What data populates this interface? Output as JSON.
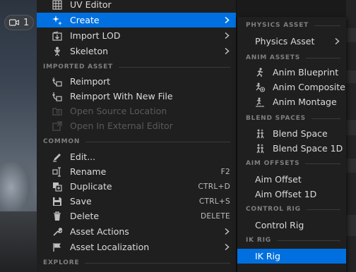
{
  "viewport": {
    "camera_label": "1"
  },
  "main_menu": {
    "items_top": [
      {
        "label": "UV Editor"
      },
      {
        "label": "Create"
      },
      {
        "label": "Import LOD"
      },
      {
        "label": "Skeleton"
      }
    ],
    "section_imported": "IMPORTED ASSET",
    "items_imported": [
      {
        "label": "Reimport"
      },
      {
        "label": "Reimport With New File"
      },
      {
        "label": "Open Source Location"
      },
      {
        "label": "Open In External Editor"
      }
    ],
    "section_common": "COMMON",
    "items_common": [
      {
        "label": "Edit...",
        "shortcut": ""
      },
      {
        "label": "Rename",
        "shortcut": "F2"
      },
      {
        "label": "Duplicate",
        "shortcut": "CTRL+D"
      },
      {
        "label": "Save",
        "shortcut": "CTRL+S"
      },
      {
        "label": "Delete",
        "shortcut": "DELETE"
      },
      {
        "label": "Asset Actions",
        "shortcut": ""
      },
      {
        "label": "Asset Localization",
        "shortcut": ""
      }
    ],
    "section_explore": "EXPLORE"
  },
  "sub_menu": {
    "section_physics": "PHYSICS ASSET",
    "physics_asset": "Physics Asset",
    "section_anim": "ANIM ASSETS",
    "anim_blueprint": "Anim Blueprint",
    "anim_composite": "Anim Composite",
    "anim_montage": "Anim Montage",
    "section_blend": "BLEND SPACES",
    "blend_space": "Blend Space",
    "blend_space_1d": "Blend Space 1D",
    "section_aim": "AIM OFFSETS",
    "aim_offset": "Aim Offset",
    "aim_offset_1d": "Aim Offset 1D",
    "section_control": "CONTROL RIG",
    "control_rig": "Control Rig",
    "section_ik": "IK RIG",
    "ik_rig": "IK Rig"
  },
  "colors": {
    "highlight": "#0070e0",
    "menu_bg": "#1f1f1f",
    "text": "#dcdcdc",
    "disabled_text": "#5a5a5a",
    "section_text": "#7f7f7f"
  }
}
